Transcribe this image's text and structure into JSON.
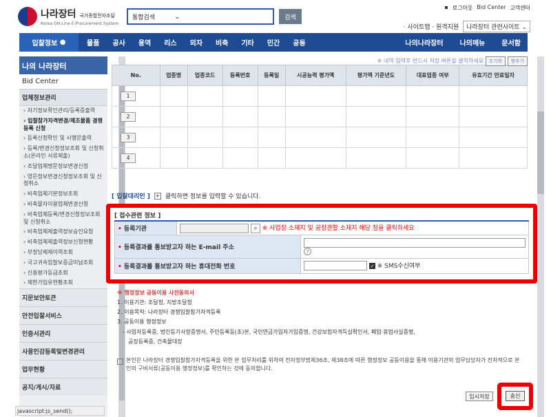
{
  "header": {
    "logo_title": "나라장터",
    "logo_subtitle_kr": "국가종합전자조달",
    "logo_subtitle_en": "Korea ON-Line E-Procurement System",
    "search_select": "통합검색",
    "search_button": "검색",
    "util_links": [
      "로그아웃",
      "Bid Center",
      "고객센터"
    ],
    "sitemap": "· 사이트맵 · 원격지원",
    "related_site": "나라장터 관련사이트"
  },
  "nav": {
    "first": "입찰정보",
    "items": [
      "물품",
      "공사",
      "용역",
      "리스",
      "외자",
      "비축",
      "기타",
      "민간",
      "공동"
    ],
    "right": [
      "나의나라장터",
      "나의메뉴",
      "문서함"
    ]
  },
  "sidebar": {
    "title": "나의 나라장터",
    "bid_center": "Bid Center",
    "section": "업체정보관리",
    "items": [
      "› 자기정보확인관리/등록증출력",
      "› 입찰참가자격변경/제조물품 경쟁 등록 신청",
      "› 등록신청확인 및 시행문출력",
      "› 등록/변경신청정보조회 및 신청취소(온라인 서류제출)",
      "› 조달업체명문정보변경신청",
      "› 영문정보변경신청정보조회 및 신청취소",
      "› 비축업체기본정보조회",
      "› 비축물자이용업체변경신청",
      "› 비축업체등록/변경신청정보조회 및 신청취소",
      "› 비축업체제출력정보승인요청",
      "› 비축업체제출력정보신청현황",
      "› 부정당제재이력조회",
      "› 국고귀속입찰보증금미납조회",
      "› 신용평가등급조회",
      "› 제한가입유현황조회"
    ],
    "bottom": [
      "지문보안토큰",
      "안전입찰서비스",
      "인증서관리",
      "사용인감등록및변경관리",
      "업무현황",
      "공지/게시/자료"
    ]
  },
  "status_bar": "javascript:js_send();",
  "content": {
    "banner": "※ 내역 입력후 반드시 저장 버튼을 클릭하세요",
    "top_buttons": [
      "조기화",
      "행추가"
    ],
    "table_headers": [
      "No.",
      "업종명",
      "업종코드",
      "등록번호",
      "등록일",
      "시공능력 평가액",
      "평가액 기준년도",
      "대표업종 여부",
      "유효기간 만료일자"
    ],
    "rows": [
      "1",
      "2",
      "3",
      "4"
    ],
    "agent_label": "[ 입찰대리인 ]",
    "agent_desc": "클릭하면 정보를 입력할 수 있습니다."
  },
  "form": {
    "section_title": "[ 접수관련 정보 ]",
    "agency_label": "등록기관",
    "agency_note": "※ 사업장 소재지 및 공장관할 소재지 해당 청을 클릭하세요",
    "email_label": "등록결과를 통보받고자 하는 E-mail 주소",
    "phone_label": "등록결과를 통보받고자 하는 휴대전화 번호",
    "sms_label": "※ SMS수신여부"
  },
  "consent": {
    "title": "※ 행정정보 공동이용 사전동의서",
    "lines": [
      "1. 이용기관: 조달청, 지방조달청",
      "2. 이용목적: 나라장터 경쟁입찰참가자격등록",
      "3. 공동이용 행정정보",
      "  - 사업자등록증, 법인등기사항증명서, 주민등록등(초)본, 국민연금가입자가입증명, 건강보험자격득실확인서, 폐업·휴업사실증명,",
      "    공장등록증, 건축물대장"
    ],
    "agree_text": "본인은 나라장터 경쟁입찰참가자격등록을 위한 본 업무처리를 위하여 전자정부법제36조, 제38조에 따른 행정정보 공동이용을 통해 이용기관의 업무담당자가 전자적으로 본인의 구비서류(공동이용 행정정보)를 확인하는 것에 동의합니다."
  },
  "actions": {
    "temp_save": "임시저장",
    "send": "송신"
  }
}
